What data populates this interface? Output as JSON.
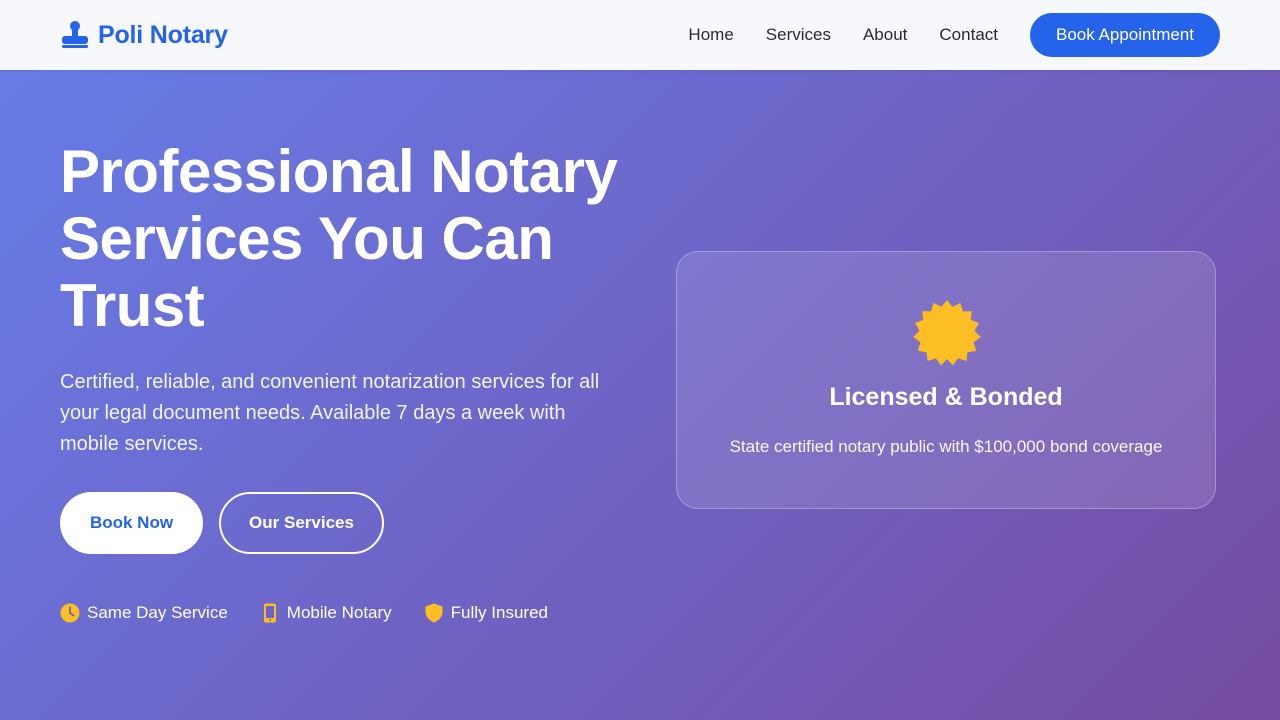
{
  "header": {
    "brand": {
      "name": "Poli Notary",
      "icon": "stamp-icon"
    },
    "nav": [
      {
        "label": "Home"
      },
      {
        "label": "Services"
      },
      {
        "label": "About"
      },
      {
        "label": "Contact"
      }
    ],
    "cta_label": "Book Appointment"
  },
  "hero": {
    "title": "Professional Notary Services You Can Trust",
    "subtitle": "Certified, reliable, and convenient notarization services for all your legal document needs. Available 7 days a week with mobile services.",
    "primary_button": "Book Now",
    "secondary_button": "Our Services",
    "features": [
      {
        "label": "Same Day Service",
        "icon": "clock-icon"
      },
      {
        "label": "Mobile Notary",
        "icon": "mobile-phone-icon"
      },
      {
        "label": "Fully Insured",
        "icon": "shield-icon"
      }
    ]
  },
  "card": {
    "icon": "certificate-icon",
    "title": "Licensed & Bonded",
    "text": "State certified notary public with $100,000 bond coverage"
  },
  "colors": {
    "brand": "#2563eb",
    "accent": "#fbbf24",
    "gradient_start": "#667eea",
    "gradient_end": "#764ba2"
  }
}
